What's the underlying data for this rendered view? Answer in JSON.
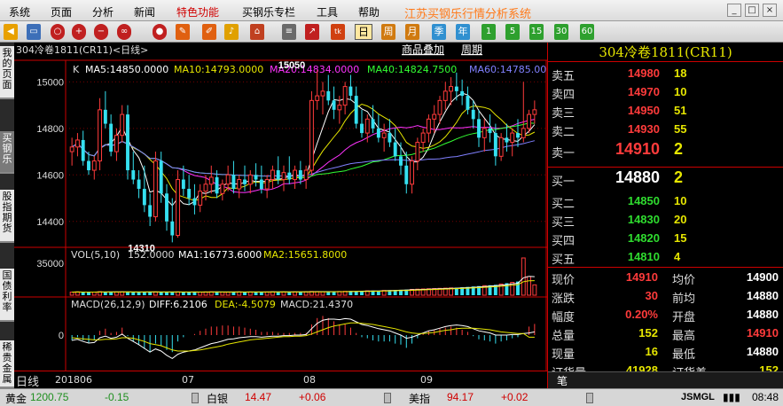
{
  "menu": {
    "items": [
      "系统",
      "页面",
      "分析",
      "新闻",
      "特色功能",
      "买钢乐专栏",
      "工具",
      "帮助"
    ],
    "highlight_index": 4,
    "app_title": "江苏买钢乐行情分析系统",
    "window_controls": [
      "_",
      "□",
      "×"
    ]
  },
  "toolbar": {
    "period_buttons": [
      "日",
      "周",
      "月",
      "季",
      "年"
    ],
    "num_buttons": [
      "1",
      "5",
      "15",
      "30",
      "60"
    ],
    "active_period": "日",
    "icon_names": [
      "back-arrow-icon",
      "monitor-icon",
      "search-icon",
      "zoom-in-icon",
      "zoom-out-icon",
      "link-icon",
      "record-icon",
      "pen-icon",
      "bell-icon",
      "home-icon",
      "list-icon",
      "chart-icon",
      "tick-icon"
    ]
  },
  "sidebar": {
    "tabs": [
      "我的页面",
      "买钢乐",
      "股指期货",
      "国债利率",
      "稀贵金属"
    ],
    "active_index": 1
  },
  "chart_header": {
    "symbol": "304冷卷1811(CR11)<日线>",
    "link1": "商品叠加",
    "link2": "周期"
  },
  "chart_data": {
    "type": "candlestick",
    "main_label": "K",
    "ma": [
      {
        "label": "MA5:14850.0000",
        "color": "#ffffff"
      },
      {
        "label": "MA10:14793.0000",
        "color": "#e6e600"
      },
      {
        "label": "MA20:14834.0000",
        "color": "#ff33ff"
      },
      {
        "label": "MA40:14824.7500",
        "color": "#33ff33"
      },
      {
        "label": "MA60:14785.0000",
        "color": "#8080ff"
      }
    ],
    "y_ticks": [
      "15000",
      "14800",
      "14600",
      "14400"
    ],
    "ylim": [
      14300,
      15070
    ],
    "annotation_high": "15050",
    "annotation_low": "14310",
    "candles": [
      [
        14700,
        14760,
        14640,
        14720
      ],
      [
        14720,
        14780,
        14680,
        14750
      ],
      [
        14750,
        14790,
        14640,
        14660
      ],
      [
        14660,
        14700,
        14600,
        14620
      ],
      [
        14620,
        14680,
        14580,
        14660
      ],
      [
        14660,
        14930,
        14620,
        14880
      ],
      [
        14880,
        14960,
        14800,
        14820
      ],
      [
        14820,
        14860,
        14680,
        14700
      ],
      [
        14700,
        14800,
        14660,
        14770
      ],
      [
        14770,
        14900,
        14740,
        14860
      ],
      [
        14860,
        14900,
        14580,
        14620
      ],
      [
        14620,
        14700,
        14560,
        14580
      ],
      [
        14580,
        14620,
        14500,
        14540
      ],
      [
        14540,
        14640,
        14440,
        14470
      ],
      [
        14470,
        14520,
        14380,
        14420
      ],
      [
        14420,
        14700,
        14400,
        14660
      ],
      [
        14660,
        14700,
        14480,
        14520
      ],
      [
        14520,
        14560,
        14360,
        14400
      ],
      [
        14400,
        14500,
        14310,
        14340
      ],
      [
        14340,
        14620,
        14330,
        14580
      ],
      [
        14580,
        14640,
        14510,
        14540
      ],
      [
        14540,
        14600,
        14470,
        14500
      ],
      [
        14500,
        14560,
        14430,
        14470
      ],
      [
        14470,
        14560,
        14440,
        14530
      ],
      [
        14530,
        14600,
        14490,
        14560
      ],
      [
        14560,
        14640,
        14520,
        14590
      ],
      [
        14590,
        14620,
        14500,
        14520
      ],
      [
        14520,
        14580,
        14490,
        14560
      ],
      [
        14560,
        14640,
        14530,
        14600
      ],
      [
        14600,
        14660,
        14520,
        14540
      ],
      [
        14540,
        14600,
        14500,
        14580
      ],
      [
        14580,
        14640,
        14530,
        14560
      ],
      [
        14560,
        14620,
        14520,
        14600
      ],
      [
        14600,
        14650,
        14550,
        14580
      ],
      [
        14580,
        14640,
        14520,
        14540
      ],
      [
        14540,
        14600,
        14500,
        14580
      ],
      [
        14580,
        14640,
        14540,
        14620
      ],
      [
        14620,
        14680,
        14560,
        14580
      ],
      [
        14580,
        14640,
        14530,
        14610
      ],
      [
        14610,
        14680,
        14560,
        14580
      ],
      [
        14580,
        14640,
        14540,
        14620
      ],
      [
        14620,
        14660,
        14560,
        14580
      ],
      [
        14580,
        14640,
        14540,
        14620
      ],
      [
        14620,
        14960,
        14600,
        14920
      ],
      [
        14920,
        15050,
        14880,
        14940
      ],
      [
        14940,
        15000,
        14860,
        14960
      ],
      [
        14960,
        15030,
        14900,
        14920
      ],
      [
        14920,
        14980,
        14840,
        14880
      ],
      [
        14880,
        14940,
        14820,
        14900
      ],
      [
        14900,
        15000,
        14860,
        14980
      ],
      [
        14980,
        15030,
        14920,
        14940
      ],
      [
        14940,
        14980,
        14800,
        14820
      ],
      [
        14820,
        14880,
        14760,
        14780
      ],
      [
        14780,
        14860,
        14740,
        14840
      ],
      [
        14840,
        14900,
        14780,
        14800
      ],
      [
        14800,
        14860,
        14740,
        14760
      ],
      [
        14760,
        14820,
        14700,
        14780
      ],
      [
        14780,
        14840,
        14720,
        14740
      ],
      [
        14740,
        14800,
        14660,
        14680
      ],
      [
        14680,
        14740,
        14600,
        14640
      ],
      [
        14640,
        14700,
        14520,
        14560
      ],
      [
        14560,
        14680,
        14520,
        14660
      ],
      [
        14660,
        14760,
        14620,
        14740
      ],
      [
        14740,
        14800,
        14700,
        14780
      ],
      [
        14780,
        14860,
        14740,
        14840
      ],
      [
        14840,
        14900,
        14780,
        14860
      ],
      [
        14860,
        14940,
        14820,
        14920
      ],
      [
        14920,
        15000,
        14880,
        14960
      ],
      [
        14960,
        15020,
        14900,
        14980
      ],
      [
        14980,
        15040,
        14920,
        14960
      ],
      [
        14960,
        15010,
        14900,
        14940
      ],
      [
        14940,
        14980,
        14860,
        14880
      ],
      [
        14880,
        14920,
        14800,
        14840
      ],
      [
        14840,
        14880,
        14720,
        14760
      ],
      [
        14760,
        14840,
        14700,
        14800
      ],
      [
        14800,
        14860,
        14740,
        14780
      ],
      [
        14780,
        14820,
        14640,
        14680
      ],
      [
        14680,
        14780,
        14660,
        14760
      ],
      [
        14760,
        14820,
        14700,
        14740
      ],
      [
        14740,
        14800,
        14680,
        14780
      ],
      [
        14780,
        14840,
        14720,
        14760
      ],
      [
        14760,
        15000,
        14740,
        14800
      ],
      [
        14800,
        14880,
        14780,
        14860
      ],
      [
        14860,
        14920,
        14820,
        14880
      ]
    ],
    "volume": {
      "label_vol": "VOL(5,10)",
      "vol_value": "152.0000",
      "label_ma1": "MA1:16773.6000",
      "label_ma2": "MA2:15651.8000",
      "y_tick": "35000",
      "ylim": [
        0,
        42000
      ],
      "values": [
        3000,
        3200,
        2800,
        3100,
        3000,
        3400,
        3200,
        3000,
        3100,
        3300,
        3200,
        3000,
        2900,
        3100,
        3300,
        3200,
        3000,
        2800,
        3100,
        3200,
        3000,
        2900,
        3100,
        3000,
        3200,
        3300,
        3100,
        3000,
        2900,
        3100,
        3200,
        3000,
        3100,
        3200,
        3000,
        3100,
        3300,
        3200,
        3100,
        3000,
        3200,
        3300,
        3400,
        3600,
        3500,
        3300,
        3200,
        3400,
        3600,
        3800,
        4000,
        3800,
        3900,
        4200,
        4400,
        4300,
        4600,
        4800,
        5000,
        5200,
        5400,
        5600,
        5800,
        6000,
        6200,
        6400,
        6600,
        6800,
        7000,
        7200,
        7600,
        8000,
        8400,
        8800,
        9200,
        9600,
        10000,
        10800,
        11600,
        12400,
        13200,
        36000,
        18000,
        10000
      ]
    },
    "macd": {
      "label": "MACD(26,12,9)",
      "diff": "DIFF:6.2106",
      "dea": "DEA:-4.5079",
      "macd": "MACD:21.4370",
      "y_tick": "0",
      "ylim": [
        -60,
        60
      ],
      "diff_values": [
        -10,
        -8,
        -12,
        -15,
        -14,
        -5,
        -2,
        -6,
        -4,
        2,
        -6,
        -12,
        -18,
        -25,
        -32,
        -26,
        -30,
        -38,
        -44,
        -36,
        -32,
        -30,
        -28,
        -24,
        -20,
        -16,
        -14,
        -11,
        -8,
        -7,
        -5,
        -4,
        -3,
        -3,
        -4,
        -3,
        -2,
        -2,
        -1,
        -1,
        0,
        0,
        1,
        12,
        22,
        28,
        30,
        30,
        29,
        31,
        30,
        25,
        20,
        18,
        15,
        12,
        10,
        8,
        4,
        0,
        -6,
        -4,
        0,
        4,
        8,
        10,
        13,
        16,
        18,
        19,
        18,
        16,
        12,
        8,
        6,
        4,
        0,
        0,
        0,
        1,
        1,
        3,
        4,
        6
      ],
      "dea_values": [
        -5,
        -6,
        -7,
        -8,
        -9,
        -9,
        -8,
        -8,
        -7,
        -5,
        -5,
        -6,
        -9,
        -12,
        -16,
        -18,
        -20,
        -24,
        -28,
        -30,
        -30,
        -30,
        -29,
        -28,
        -26,
        -24,
        -22,
        -20,
        -17,
        -15,
        -13,
        -11,
        -9,
        -8,
        -7,
        -6,
        -5,
        -4,
        -3,
        -3,
        -2,
        -2,
        -1,
        2,
        6,
        10,
        14,
        17,
        19,
        21,
        23,
        23,
        22,
        21,
        20,
        18,
        16,
        14,
        12,
        9,
        6,
        4,
        3,
        3,
        4,
        5,
        7,
        9,
        10,
        12,
        13,
        13,
        13,
        12,
        11,
        10,
        8,
        6,
        5,
        4,
        3,
        3,
        -4,
        -4
      ],
      "hist_values": [
        -10,
        -4,
        -10,
        -14,
        -10,
        8,
        12,
        4,
        6,
        14,
        -2,
        -12,
        -18,
        -26,
        -32,
        -16,
        -20,
        -28,
        -32,
        -12,
        -4,
        0,
        2,
        8,
        12,
        16,
        16,
        18,
        18,
        16,
        16,
        14,
        12,
        10,
        6,
        6,
        6,
        4,
        4,
        4,
        4,
        4,
        4,
        20,
        32,
        36,
        32,
        26,
        20,
        20,
        14,
        4,
        -4,
        -6,
        -10,
        -12,
        -12,
        -12,
        -16,
        -18,
        -24,
        -16,
        -6,
        2,
        8,
        10,
        12,
        14,
        16,
        14,
        10,
        6,
        -2,
        -8,
        -10,
        -12,
        -16,
        -12,
        -10,
        -6,
        -4,
        0,
        16,
        21
      ]
    },
    "x_ticks": [
      {
        "label": "201806",
        "at": 0
      },
      {
        "label": "07",
        "at": 0.24
      },
      {
        "label": "08",
        "at": 0.5
      },
      {
        "label": "09",
        "at": 0.75
      }
    ]
  },
  "quote": {
    "title": "304冷卷1811(CR11)",
    "asks": [
      {
        "label": "卖五",
        "price": "14980",
        "vol": "18"
      },
      {
        "label": "卖四",
        "price": "14970",
        "vol": "10"
      },
      {
        "label": "卖三",
        "price": "14950",
        "vol": "51"
      },
      {
        "label": "卖二",
        "price": "14930",
        "vol": "55"
      },
      {
        "label": "卖一",
        "price": "14910",
        "vol": "2"
      }
    ],
    "bids": [
      {
        "label": "买一",
        "price": "14880",
        "vol": "2"
      },
      {
        "label": "买二",
        "price": "14850",
        "vol": "10"
      },
      {
        "label": "买三",
        "price": "14830",
        "vol": "20"
      },
      {
        "label": "买四",
        "price": "14820",
        "vol": "15"
      },
      {
        "label": "买五",
        "price": "14810",
        "vol": "4"
      }
    ],
    "stats": [
      {
        "l1": "现价",
        "v1": "14910",
        "c1": "r",
        "l2": "均价",
        "v2": "14900",
        "c2": "w"
      },
      {
        "l1": "涨跌",
        "v1": "30",
        "c1": "r",
        "l2": "前均",
        "v2": "14880",
        "c2": "w"
      },
      {
        "l1": "幅度",
        "v1": "0.20%",
        "c1": "r",
        "l2": "开盘",
        "v2": "14880",
        "c2": "w"
      },
      {
        "l1": "总量",
        "v1": "152",
        "c1": "y",
        "l2": "最高",
        "v2": "14910",
        "c2": "r"
      },
      {
        "l1": "现量",
        "v1": "16",
        "c1": "y",
        "l2": "最低",
        "v2": "14880",
        "c2": "w"
      },
      {
        "l1": "订货量",
        "v1": "41928",
        "c1": "y",
        "l2": "订货差",
        "v2": "152",
        "c2": "y"
      }
    ],
    "footer_tab": "笔"
  },
  "xaxis": {
    "label": "日线"
  },
  "status": {
    "items": [
      {
        "name": "黄金",
        "price": "1200.75",
        "change": "-0.15"
      },
      {
        "name": "白银",
        "price": "14.47",
        "change": "+0.06"
      },
      {
        "name": "美指",
        "price": "94.17",
        "change": "+0.02"
      }
    ],
    "brand": "JSMGL",
    "time": "08:48"
  }
}
